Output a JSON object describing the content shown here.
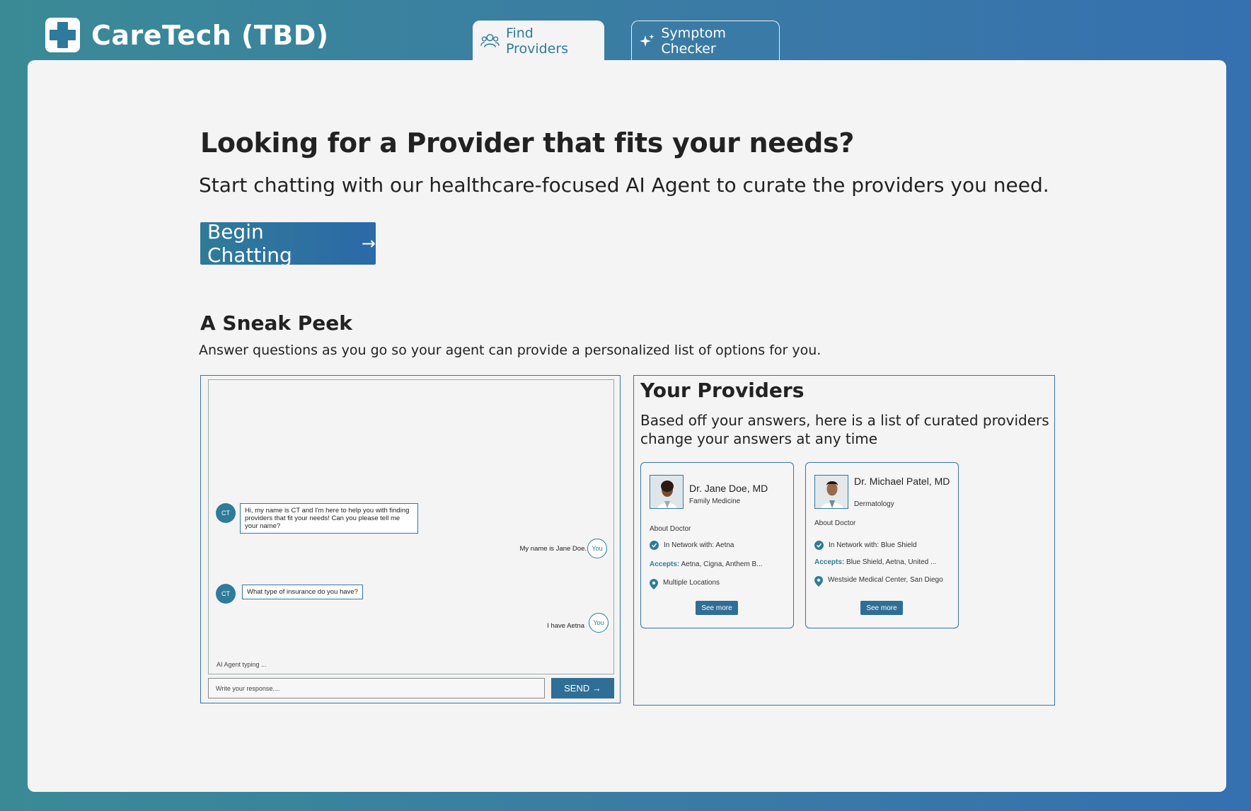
{
  "header": {
    "brand": "CareTech (TBD)",
    "tabs": [
      {
        "label": "Find Providers",
        "icon": "users-icon",
        "active": true
      },
      {
        "label": "Symptom Checker",
        "icon": "sparkles-icon",
        "active": false
      }
    ]
  },
  "hero": {
    "title": "Looking for a Provider that fits your needs?",
    "subtitle": "Start chatting with our healthcare-focused AI Agent to curate the providers you need.",
    "cta_label": "Begin Chatting",
    "cta_arrow": "→"
  },
  "sneak_peek": {
    "title": "A Sneak Peek",
    "subtitle": "Answer questions as you go so your agent can provide a personalized list of options for you."
  },
  "chat": {
    "agent_initials": "CT",
    "user_initials": "You",
    "messages": [
      {
        "from": "agent",
        "text": "Hi, my name is CT and I'm here to help you with finding providers that fit your needs! Can you please tell me your name?"
      },
      {
        "from": "user",
        "text": "My name is Jane Doe."
      },
      {
        "from": "agent",
        "text": "What type of insurance do you have?"
      },
      {
        "from": "user",
        "text": "I have Aetna"
      }
    ],
    "typing_status": "AI Agent typing ...",
    "input_placeholder": "Write your response....",
    "send_label": "SEND →"
  },
  "providers": {
    "title": "Your Providers",
    "subtitle_line1": "Based off your answers, here is a list of curated providers",
    "subtitle_line2": "change your answers at any time",
    "cards": [
      {
        "name": "Dr. Jane Doe, MD",
        "specialty": "Family Medicine",
        "about_label": "About Doctor",
        "network": "In Network with: Aetna",
        "accepts_label": "Accepts:",
        "accepts": "Aetna, Cigna, Anthem B...",
        "location": "Multiple Locations",
        "see_more": "See more"
      },
      {
        "name": "Dr. Michael Patel, MD",
        "specialty": "Dermatology",
        "about_label": "About Doctor",
        "network": "In Network with: Blue Shield",
        "accepts_label": "Accepts:",
        "accepts": "Blue Shield, Aetna, United ...",
        "location": "Westside Medical Center, San Diego",
        "see_more": "See more"
      }
    ]
  },
  "colors": {
    "accent": "#2f7b9a",
    "border_blue": "#3276a8",
    "panel_bg": "#f4f4f4"
  }
}
